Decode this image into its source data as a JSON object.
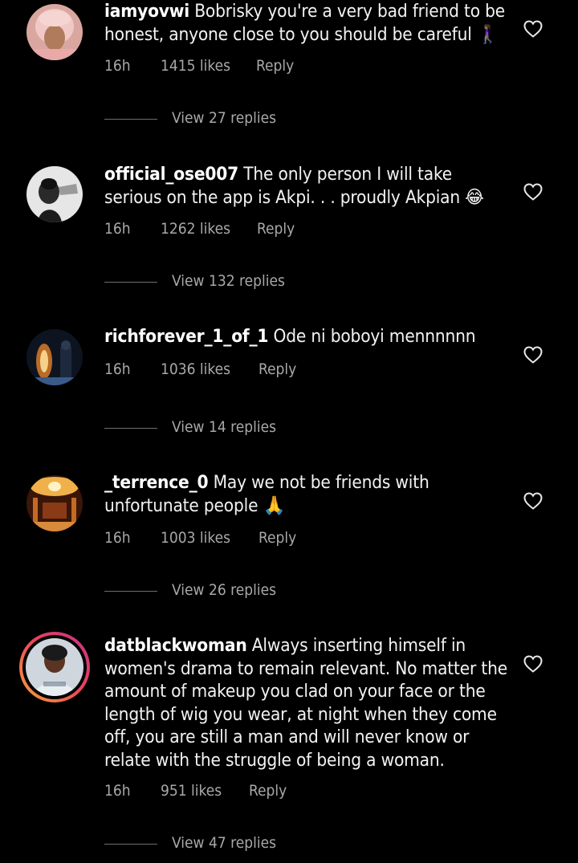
{
  "comments": [
    {
      "username": "iamyovwi",
      "text": "Bobrisky you're a very bad friend to be honest, anyone close to you should be careful 🚶🏾‍♀️",
      "time": "16h",
      "likes": "1415 likes",
      "reply_label": "Reply",
      "view_replies": "View 27 replies",
      "avatar_icon": "profile-photo-woman-pink-hair"
    },
    {
      "username": "official_ose007",
      "text": "The only person I will take serious on the app is Akpi. . . proudly Akpian 😂",
      "time": "16h",
      "likes": "1262 likes",
      "reply_label": "Reply",
      "view_replies": "View 132 replies",
      "avatar_icon": "profile-photo-bw-portrait"
    },
    {
      "username": "richforever_1_of_1",
      "text": "Ode ni boboyi mennnnnn",
      "time": "16h",
      "likes": "1036 likes",
      "reply_label": "Reply",
      "view_replies": "View 14 replies",
      "avatar_icon": "profile-photo-night-fire"
    },
    {
      "username": "_terrence_0",
      "text": "May we not be friends with unfortunate people 🙏",
      "time": "16h",
      "likes": "1003 likes",
      "reply_label": "Reply",
      "view_replies": "View 26 replies",
      "avatar_icon": "profile-photo-ornate-hall"
    },
    {
      "username": "datblackwoman",
      "text": "Always inserting himself in women's drama to remain relevant. No matter the amount of makeup you clad on your face or the length of wig you wear, at night when they come off, you are still a man and will never know or relate with the struggle of being a woman.",
      "time": "16h",
      "likes": "951 likes",
      "reply_label": "Reply",
      "view_replies": "View 47 replies",
      "avatar_icon": "profile-photo-woman-story-ring"
    }
  ],
  "colors": {
    "background": "#000000",
    "primary_text": "#f2f2f2",
    "secondary_text": "#a8a8a8",
    "story_ring": "#e9435a"
  }
}
